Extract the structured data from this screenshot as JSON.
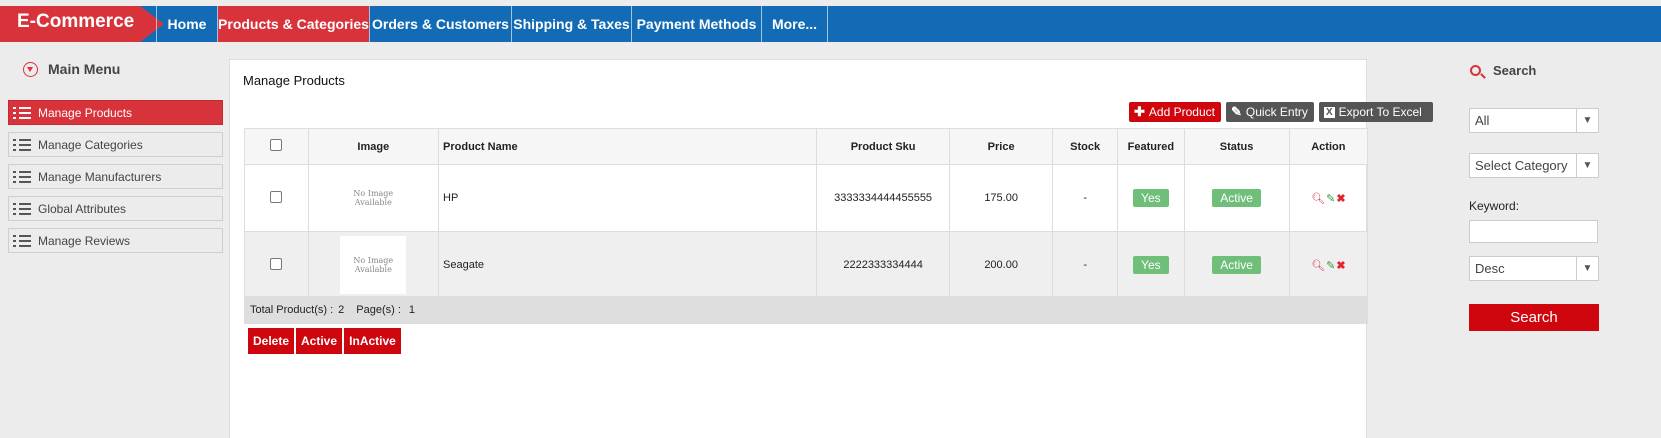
{
  "brand": "E-Commerce",
  "nav": [
    {
      "label": "Home"
    },
    {
      "label": "Products & Categories"
    },
    {
      "label": "Orders & Customers"
    },
    {
      "label": "Shipping & Taxes"
    },
    {
      "label": "Payment Methods"
    },
    {
      "label": "More..."
    }
  ],
  "sidebar": {
    "title": "Main Menu",
    "items": [
      {
        "label": "Manage Products"
      },
      {
        "label": "Manage Categories"
      },
      {
        "label": "Manage Manufacturers"
      },
      {
        "label": "Global Attributes"
      },
      {
        "label": "Manage Reviews"
      }
    ]
  },
  "main": {
    "title": "Manage Products",
    "toolbar": {
      "add": "Add Product",
      "quick": "Quick Entry",
      "export": "Export To Excel"
    },
    "columns": [
      "Image",
      "Product Name",
      "Product Sku",
      "Price",
      "Stock",
      "Featured",
      "Status",
      "Action"
    ],
    "rows": [
      {
        "image": "No Image Available",
        "name": "HP",
        "sku": "3333334444455555",
        "price": "175.00",
        "stock": "-",
        "featured": "Yes",
        "status": "Active"
      },
      {
        "image": "No Image Available",
        "name": "Seagate",
        "sku": "2222333334444",
        "price": "200.00",
        "stock": "-",
        "featured": "Yes",
        "status": "Active"
      }
    ],
    "footer": {
      "total_label": "Total Product(s) :",
      "total": "2",
      "pages_label": "Page(s) :",
      "pages": "1"
    },
    "bulk": {
      "delete": "Delete",
      "active": "Active",
      "inactive": "InActive"
    }
  },
  "search": {
    "title": "Search",
    "filter": "All",
    "category": "Select Category",
    "keyword_label": "Keyword:",
    "keyword": "",
    "order": "Desc",
    "button": "Search"
  },
  "colors": {
    "nav_blue": "#136bb5",
    "accent_red": "#d8333a",
    "button_red": "#d0060f",
    "toolbar_dark": "#555555",
    "badge_green": "#6fbf7a"
  }
}
